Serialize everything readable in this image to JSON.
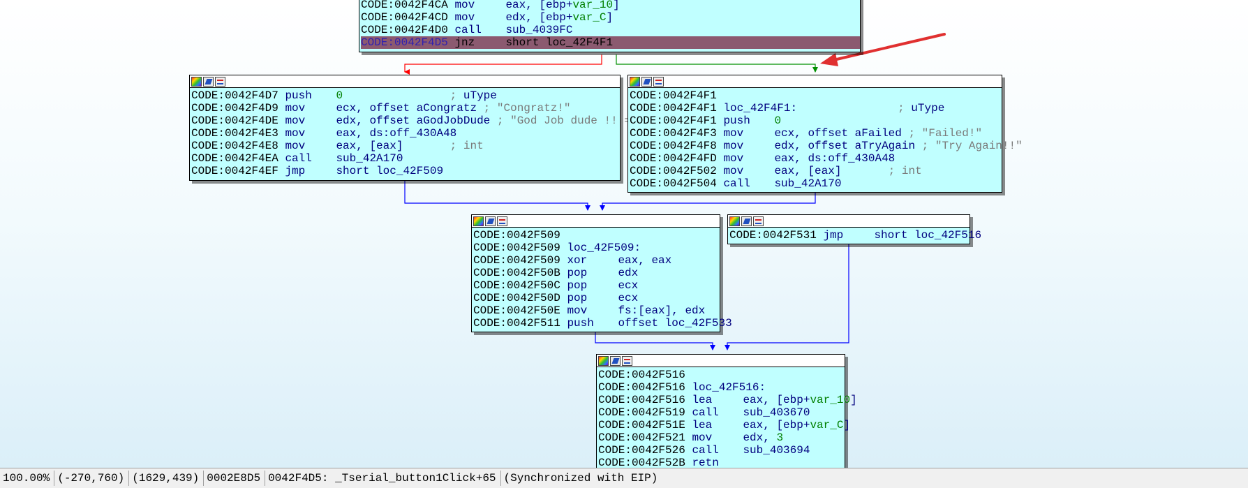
{
  "window": {
    "title": ""
  },
  "colors": {
    "node_bg": "#c0ffff",
    "selected_line": "#8b5a70",
    "edge_true": "#009000",
    "edge_false": "#ff0000",
    "edge_uncond": "#0000ff",
    "annotation_arrow": "#e03030"
  },
  "header_icons": [
    "color-icon",
    "rename-icon",
    "graph-icon"
  ],
  "nodes": {
    "top": {
      "lines": [
        {
          "addr": "CODE:0042F4CA",
          "mn": "mov",
          "ops": [
            {
              "t": "eax, [ebp+",
              "c": "ops"
            },
            {
              "t": "var_10",
              "c": "var"
            },
            {
              "t": "]",
              "c": "ops"
            }
          ]
        },
        {
          "addr": "CODE:0042F4CD",
          "mn": "mov",
          "ops": [
            {
              "t": "edx, [ebp+",
              "c": "ops"
            },
            {
              "t": "var_C",
              "c": "var"
            },
            {
              "t": "]",
              "c": "ops"
            }
          ]
        },
        {
          "addr": "CODE:0042F4D0",
          "mn": "call",
          "ops": [
            {
              "t": "sub_4039FC",
              "c": "ops"
            }
          ]
        },
        {
          "addr": "CODE:0042F4D5",
          "mn": "jnz",
          "ops": [
            {
              "t": "short loc_42F4F1",
              "c": "ops"
            }
          ],
          "selected": true
        }
      ]
    },
    "congrats": {
      "lines": [
        {
          "addr": "CODE:0042F4D7",
          "mn": "push",
          "ops": [
            {
              "t": "0",
              "c": "num"
            },
            {
              "t": "                ; ",
              "c": "cmt"
            },
            {
              "t": "uType",
              "c": "lbl"
            }
          ]
        },
        {
          "addr": "CODE:0042F4D9",
          "mn": "mov",
          "ops": [
            {
              "t": "ecx, offset aCongratz",
              "c": "ops"
            },
            {
              "t": " ; \"Congratz!\"",
              "c": "cmt"
            }
          ]
        },
        {
          "addr": "CODE:0042F4DE",
          "mn": "mov",
          "ops": [
            {
              "t": "edx, offset aGodJobDude",
              "c": "ops"
            },
            {
              "t": " ; \"God Job dude !! =)\"",
              "c": "cmt"
            }
          ]
        },
        {
          "addr": "CODE:0042F4E3",
          "mn": "mov",
          "ops": [
            {
              "t": "eax, ds:off_430A48",
              "c": "ops"
            }
          ]
        },
        {
          "addr": "CODE:0042F4E8",
          "mn": "mov",
          "ops": [
            {
              "t": "eax, [eax]",
              "c": "ops"
            },
            {
              "t": "       ; int",
              "c": "cmt"
            }
          ]
        },
        {
          "addr": "CODE:0042F4EA",
          "mn": "call",
          "ops": [
            {
              "t": "sub_42A170",
              "c": "ops"
            }
          ]
        },
        {
          "addr": "CODE:0042F4EF",
          "mn": "jmp",
          "ops": [
            {
              "t": "short loc_42F509",
              "c": "ops"
            }
          ]
        }
      ]
    },
    "failed": {
      "lines": [
        {
          "addr": "CODE:0042F4F1",
          "mn": "",
          "ops": []
        },
        {
          "addr": "CODE:0042F4F1",
          "mn": "",
          "ops": [
            {
              "t": "loc_42F4F1:",
              "c": "lbl"
            },
            {
              "t": "               ; ",
              "c": "cmt"
            },
            {
              "t": "uType",
              "c": "lbl"
            }
          ]
        },
        {
          "addr": "CODE:0042F4F1",
          "mn": "push",
          "ops": [
            {
              "t": "0",
              "c": "num"
            }
          ]
        },
        {
          "addr": "CODE:0042F4F3",
          "mn": "mov",
          "ops": [
            {
              "t": "ecx, offset aFailed",
              "c": "ops"
            },
            {
              "t": " ; \"Failed!\"",
              "c": "cmt"
            }
          ]
        },
        {
          "addr": "CODE:0042F4F8",
          "mn": "mov",
          "ops": [
            {
              "t": "edx, offset aTryAgain",
              "c": "ops"
            },
            {
              "t": " ; \"Try Again!!\"",
              "c": "cmt"
            }
          ]
        },
        {
          "addr": "CODE:0042F4FD",
          "mn": "mov",
          "ops": [
            {
              "t": "eax, ds:off_430A48",
              "c": "ops"
            }
          ]
        },
        {
          "addr": "CODE:0042F502",
          "mn": "mov",
          "ops": [
            {
              "t": "eax, [eax]",
              "c": "ops"
            },
            {
              "t": "       ; int",
              "c": "cmt"
            }
          ]
        },
        {
          "addr": "CODE:0042F504",
          "mn": "call",
          "ops": [
            {
              "t": "sub_42A170",
              "c": "ops"
            }
          ]
        }
      ]
    },
    "merge": {
      "lines": [
        {
          "addr": "CODE:0042F509",
          "mn": "",
          "ops": []
        },
        {
          "addr": "CODE:0042F509",
          "mn": "",
          "ops": [
            {
              "t": "loc_42F509:",
              "c": "lbl"
            }
          ]
        },
        {
          "addr": "CODE:0042F509",
          "mn": "xor",
          "ops": [
            {
              "t": "eax, eax",
              "c": "ops"
            }
          ]
        },
        {
          "addr": "CODE:0042F50B",
          "mn": "pop",
          "ops": [
            {
              "t": "edx",
              "c": "ops"
            }
          ]
        },
        {
          "addr": "CODE:0042F50C",
          "mn": "pop",
          "ops": [
            {
              "t": "ecx",
              "c": "ops"
            }
          ]
        },
        {
          "addr": "CODE:0042F50D",
          "mn": "pop",
          "ops": [
            {
              "t": "ecx",
              "c": "ops"
            }
          ]
        },
        {
          "addr": "CODE:0042F50E",
          "mn": "mov",
          "ops": [
            {
              "t": "fs:[eax], edx",
              "c": "ops"
            }
          ]
        },
        {
          "addr": "CODE:0042F511",
          "mn": "push",
          "ops": [
            {
              "t": "offset loc_42F533",
              "c": "ops"
            }
          ]
        }
      ]
    },
    "jmpnode": {
      "lines": [
        {
          "addr": "CODE:0042F531",
          "mn": "jmp",
          "ops": [
            {
              "t": "short loc_42F516",
              "c": "ops"
            }
          ]
        }
      ]
    },
    "bottom": {
      "lines": [
        {
          "addr": "CODE:0042F516",
          "mn": "",
          "ops": []
        },
        {
          "addr": "CODE:0042F516",
          "mn": "",
          "ops": [
            {
              "t": "loc_42F516:",
              "c": "lbl"
            }
          ]
        },
        {
          "addr": "CODE:0042F516",
          "mn": "lea",
          "ops": [
            {
              "t": "eax, [ebp+",
              "c": "ops"
            },
            {
              "t": "var_10",
              "c": "var"
            },
            {
              "t": "]",
              "c": "ops"
            }
          ]
        },
        {
          "addr": "CODE:0042F519",
          "mn": "call",
          "ops": [
            {
              "t": "sub_403670",
              "c": "ops"
            }
          ]
        },
        {
          "addr": "CODE:0042F51E",
          "mn": "lea",
          "ops": [
            {
              "t": "eax, [ebp+",
              "c": "ops"
            },
            {
              "t": "var_C",
              "c": "var"
            },
            {
              "t": "]",
              "c": "ops"
            }
          ]
        },
        {
          "addr": "CODE:0042F521",
          "mn": "mov",
          "ops": [
            {
              "t": "edx, ",
              "c": "ops"
            },
            {
              "t": "3",
              "c": "num"
            }
          ]
        },
        {
          "addr": "CODE:0042F526",
          "mn": "call",
          "ops": [
            {
              "t": "sub_403694",
              "c": "ops"
            }
          ]
        },
        {
          "addr": "CODE:0042F52B",
          "mn": "retn",
          "ops": []
        }
      ]
    }
  },
  "statusbar": {
    "zoom": "100.00%",
    "graph_coords": "(-270,760)",
    "mouse_coords": "(1629,439)",
    "file_offset": "0002E8D5",
    "location": "0042F4D5: _Tserial_button1Click+65",
    "sync": "(Synchronized with EIP)"
  }
}
